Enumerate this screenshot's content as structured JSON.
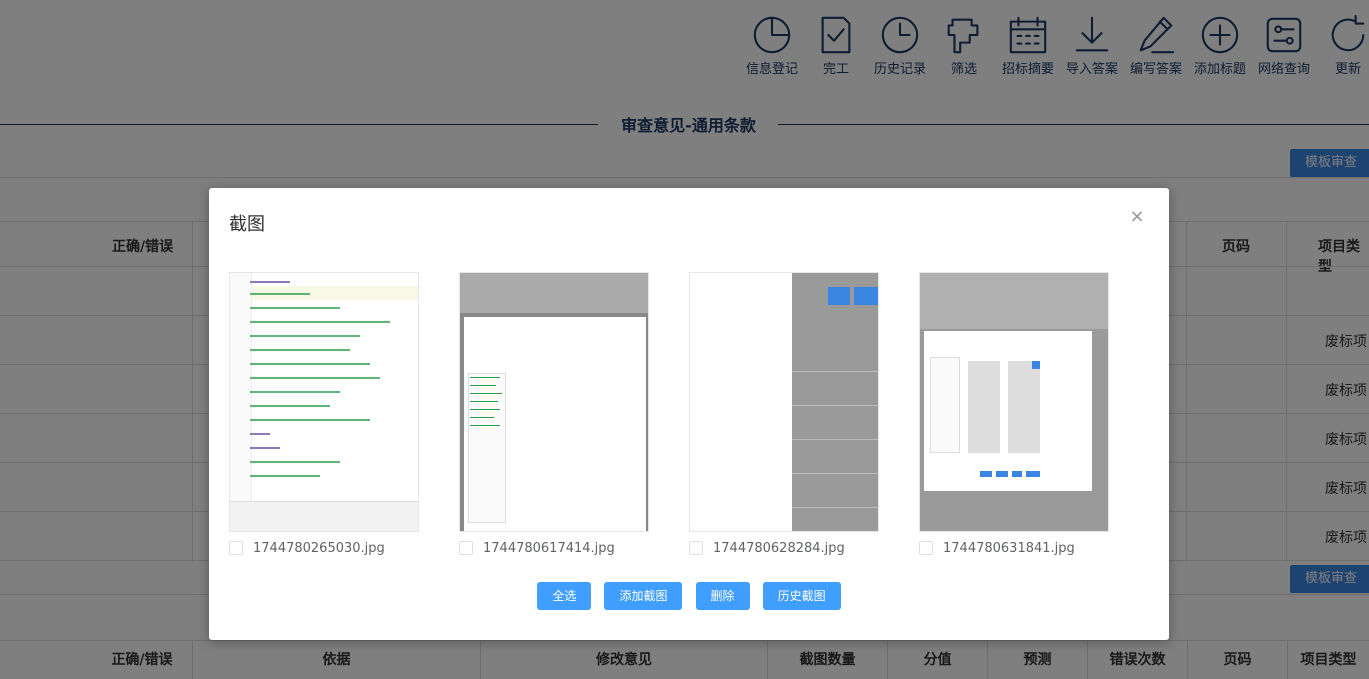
{
  "toolbar": {
    "items": [
      {
        "label": "信息登记",
        "icon": "pie-chart-icon"
      },
      {
        "label": "完工",
        "icon": "checked-doc-icon"
      },
      {
        "label": "历史记录",
        "icon": "clock-icon"
      },
      {
        "label": "筛选",
        "icon": "filter-icon"
      },
      {
        "label": "招标摘要",
        "icon": "calendar-icon"
      },
      {
        "label": "导入答案",
        "icon": "download-icon"
      },
      {
        "label": "编写答案",
        "icon": "pencil-icon"
      },
      {
        "label": "添加标题",
        "icon": "plus-circle-icon"
      },
      {
        "label": "网络查询",
        "icon": "network-icon"
      },
      {
        "label": "更新",
        "icon": "refresh-icon"
      }
    ]
  },
  "section": {
    "title": "审查意见-通用条款"
  },
  "template_review_label": "模板审查",
  "bg_table": {
    "header_left": "正确/错误",
    "header_page": "页码",
    "header_type": "项目类型",
    "row_type": "废标项"
  },
  "footer_header": {
    "cols": [
      "正确/错误",
      "依据",
      "修改意见",
      "截图数量",
      "分值",
      "预测",
      "错误次数",
      "页码",
      "项目类型"
    ]
  },
  "dialog": {
    "title": "截图",
    "close": "×",
    "thumbnails": [
      {
        "name": "1744780265030.jpg",
        "checked": false
      },
      {
        "name": "1744780617414.jpg",
        "checked": false
      },
      {
        "name": "1744780628284.jpg",
        "checked": false
      },
      {
        "name": "1744780631841.jpg",
        "checked": false
      }
    ],
    "actions": {
      "select_all": "全选",
      "add": "添加截图",
      "delete": "删除",
      "history": "历史截图"
    }
  },
  "colors": {
    "primary": "#409eff",
    "nav": "#1f3a66",
    "overlay": "rgba(0,0,0,0.5)"
  }
}
